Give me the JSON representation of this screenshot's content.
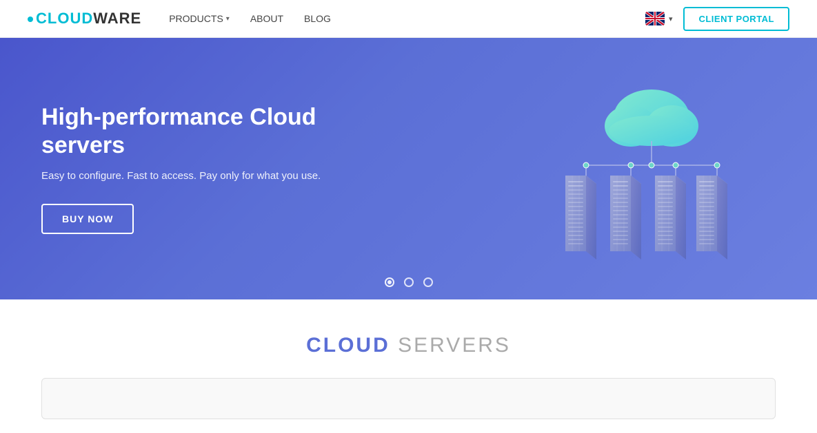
{
  "navbar": {
    "logo_text_main": "CLOUDWARE",
    "logo_text_highlight": "CLOUD",
    "nav_items": [
      {
        "label": "PRODUCTS",
        "has_dropdown": true
      },
      {
        "label": "ABOUT",
        "has_dropdown": false
      },
      {
        "label": "BLOG",
        "has_dropdown": false
      }
    ],
    "client_portal_label": "CLIENT PORTAL",
    "lang_arrow": "▾"
  },
  "hero": {
    "title": "High-performance Cloud servers",
    "subtitle": "Easy to configure. Fast to access. Pay only for what you use.",
    "cta_label": "BUY NOW",
    "dots": [
      {
        "active": true
      },
      {
        "active": false
      },
      {
        "active": false
      }
    ]
  },
  "cloud_servers_section": {
    "title_highlight": "CLOUD",
    "title_normal": " SERVERS"
  },
  "colors": {
    "accent": "#00bcd4",
    "hero_bg_start": "#4a56cc",
    "hero_bg_end": "#6b7fe0",
    "section_title_blue": "#5b6fd6"
  }
}
